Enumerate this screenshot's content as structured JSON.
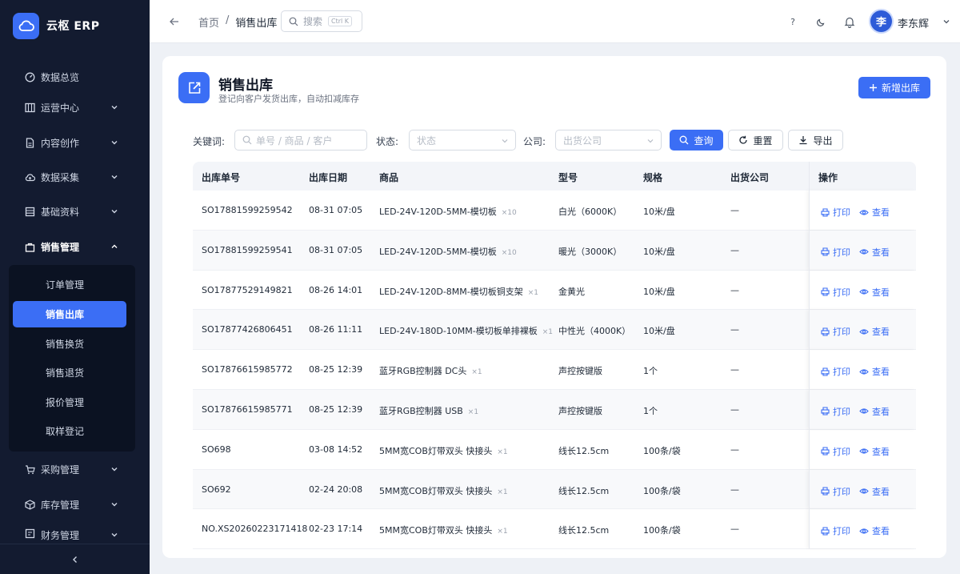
{
  "brand": {
    "name": "云枢 ERP",
    "icon": "cloud-icon"
  },
  "sidebar": {
    "items": [
      {
        "label": "数据总览",
        "icon": "dashboard-icon",
        "has_children": false
      },
      {
        "label": "运营中心",
        "icon": "grid-icon",
        "has_children": true
      },
      {
        "label": "内容创作",
        "icon": "document-icon",
        "has_children": true
      },
      {
        "label": "数据采集",
        "icon": "cloud-upload-icon",
        "has_children": true
      },
      {
        "label": "基础资料",
        "icon": "list-icon",
        "has_children": true
      },
      {
        "label": "销售管理",
        "icon": "bag-icon",
        "has_children": true,
        "expanded": true
      },
      {
        "label": "采购管理",
        "icon": "cart-icon",
        "has_children": true
      },
      {
        "label": "库存管理",
        "icon": "box-icon",
        "has_children": true
      },
      {
        "label": "财务管理",
        "icon": "ledger-icon",
        "has_children": true
      }
    ],
    "sub_items": [
      {
        "label": "订单管理",
        "active": false
      },
      {
        "label": "销售出库",
        "active": true
      },
      {
        "label": "销售换货",
        "active": false
      },
      {
        "label": "销售退货",
        "active": false
      },
      {
        "label": "报价管理",
        "active": false
      },
      {
        "label": "取样登记",
        "active": false
      }
    ]
  },
  "topbar": {
    "breadcrumb": [
      "首页",
      "/",
      "销售出库"
    ],
    "search": {
      "placeholder": "搜索",
      "shortcut": "Ctrl K"
    },
    "help": "?",
    "user": {
      "avatar_char": "李",
      "name": "李东辉"
    }
  },
  "page": {
    "title": "销售出库",
    "subtitle": "登记向客户发货出库，自动扣减库存",
    "add_button": "新增出库"
  },
  "filters": {
    "keyword_label": "关键词:",
    "keyword_placeholder": "单号 / 商品 / 客户",
    "status_label": "状态:",
    "status_placeholder": "状态",
    "company_label": "公司:",
    "company_placeholder": "出货公司",
    "query_button": "查询",
    "reset_button": "重置",
    "export_button": "导出"
  },
  "table": {
    "columns": [
      "出库单号",
      "出库日期",
      "商品",
      "型号",
      "规格",
      "出货公司",
      "操作"
    ],
    "actions": {
      "print": "打印",
      "view": "查看"
    },
    "rows": [
      {
        "no": "SO17881599259542",
        "date": "08-31 07:05",
        "product": "LED-24V-120D-5MM-模切板",
        "qty": "×10",
        "model": "白光（6000K）",
        "spec": "10米/盘",
        "company": "—"
      },
      {
        "no": "SO17881599259541",
        "date": "08-31 07:05",
        "product": "LED-24V-120D-5MM-模切板",
        "qty": "×10",
        "model": "暖光（3000K）",
        "spec": "10米/盘",
        "company": "—"
      },
      {
        "no": "SO17877529149821",
        "date": "08-26 14:01",
        "product": "LED-24V-120D-8MM-模切板铜支架",
        "qty": "×1",
        "model": "金黄光",
        "spec": "10米/盘",
        "company": "—"
      },
      {
        "no": "SO17877426806451",
        "date": "08-26 11:11",
        "product": "LED-24V-180D-10MM-模切板单排裸板",
        "qty": "×1",
        "model": "中性光（4000K）",
        "spec": "10米/盘",
        "company": "—"
      },
      {
        "no": "SO17876615985772",
        "date": "08-25 12:39",
        "product": "蓝牙RGB控制器 DC头",
        "qty": "×1",
        "model": "声控按键版",
        "spec": "1个",
        "company": "—"
      },
      {
        "no": "SO17876615985771",
        "date": "08-25 12:39",
        "product": "蓝牙RGB控制器 USB",
        "qty": "×1",
        "model": "声控按键版",
        "spec": "1个",
        "company": "—"
      },
      {
        "no": "SO698",
        "date": "03-08 14:52",
        "product": "5MM宽COB灯带双头 快接头",
        "qty": "×1",
        "model": "线长12.5cm",
        "spec": "100条/袋",
        "company": "—"
      },
      {
        "no": "SO692",
        "date": "02-24 20:08",
        "product": "5MM宽COB灯带双头 快接头",
        "qty": "×1",
        "model": "线长12.5cm",
        "spec": "100条/袋",
        "company": "—"
      },
      {
        "no": "NO.XS20260223171418",
        "date": "02-23 17:14",
        "product": "5MM宽COB灯带双头 快接头",
        "qty": "×1",
        "model": "线长12.5cm",
        "spec": "100条/袋",
        "company": "—"
      }
    ]
  },
  "colors": {
    "primary": "#3b6ef5",
    "sidebar_bg": "#131b30"
  }
}
